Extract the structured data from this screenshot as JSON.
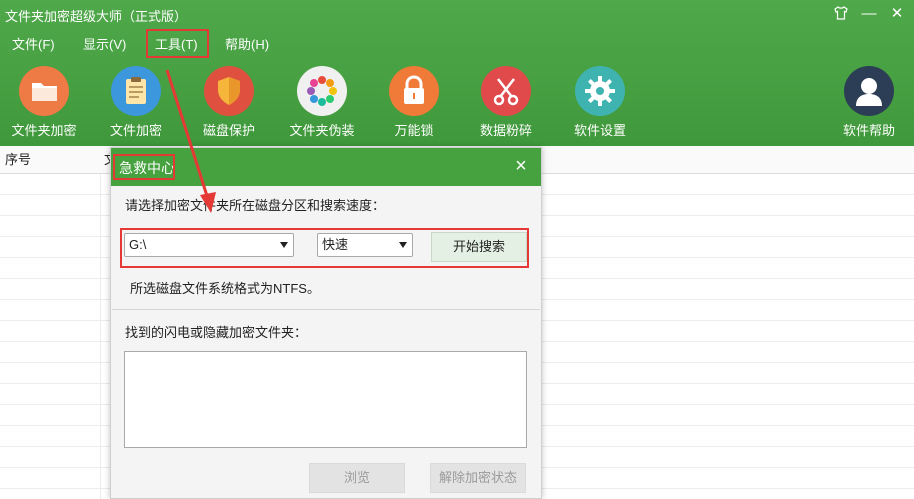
{
  "window": {
    "title": "文件夹加密超级大师（正式版）",
    "controls": {
      "skin": "skin-icon",
      "minimize": "—",
      "close": "✕"
    }
  },
  "menu": {
    "items": [
      {
        "label": "文件(F)"
      },
      {
        "label": "显示(V)"
      },
      {
        "label": "工具(T)"
      },
      {
        "label": "帮助(H)"
      }
    ]
  },
  "toolbar": {
    "items": [
      {
        "label": "文件夹加密",
        "icon": "folder-icon",
        "color": "#ee7a45"
      },
      {
        "label": "文件加密",
        "icon": "clipboard-icon",
        "color": "#3d97dc"
      },
      {
        "label": "磁盘保护",
        "icon": "shield-icon",
        "color": "#e0503e"
      },
      {
        "label": "文件夹伪装",
        "icon": "color-wheel-icon",
        "color": "#f0f0f0"
      },
      {
        "label": "万能锁",
        "icon": "padlock-icon",
        "color": "#f07a38"
      },
      {
        "label": "数据粉碎",
        "icon": "scissors-icon",
        "color": "#e04a4a"
      },
      {
        "label": "软件设置",
        "icon": "gear-icon",
        "color": "#3fb3b0"
      },
      {
        "label": "软件帮助",
        "icon": "user-icon",
        "color": "#2c3e55"
      }
    ]
  },
  "list": {
    "columns": [
      {
        "label": "序号"
      },
      {
        "label": "文"
      }
    ]
  },
  "dialog": {
    "title": "急救中心",
    "prompt": "请选择加密文件夹所在磁盘分区和搜索速度：",
    "drive_select": "G:\\",
    "speed_select": "快速",
    "start_button": "开始搜索",
    "fs_info": "所选磁盘文件系统格式为NTFS。",
    "found_label": "找到的闪电或隐藏加密文件夹：",
    "browse_button": "浏览",
    "decrypt_button": "解除加密状态"
  },
  "colors": {
    "brand_green": "#47a042",
    "highlight_red": "#e53935"
  }
}
